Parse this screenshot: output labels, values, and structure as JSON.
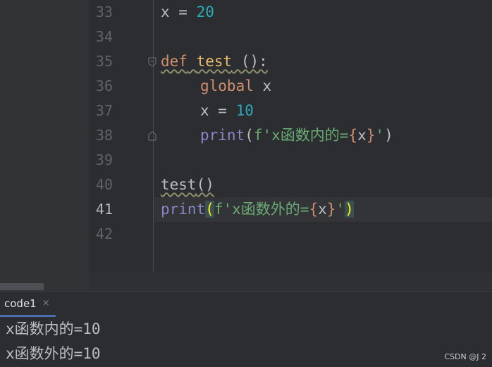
{
  "editor": {
    "line_numbers": [
      "33",
      "34",
      "35",
      "36",
      "37",
      "38",
      "39",
      "40",
      "41",
      "42"
    ],
    "active_line": "41",
    "lines": {
      "l33": {
        "var": "x",
        "op": " = ",
        "num": "20"
      },
      "l35": {
        "kw": "def",
        "space": " ",
        "name": "test",
        "parens": " ():"
      },
      "l36": {
        "kw": "global",
        "space": " ",
        "var": "x"
      },
      "l37": {
        "var": "x",
        "op": " = ",
        "num": "10"
      },
      "l38": {
        "builtin": "print",
        "open": "(",
        "str_start": "f'x函数内的=",
        "brace_open": "{",
        "var": "x",
        "brace_close": "}",
        "str_end": "'",
        "close": ")"
      },
      "l40": {
        "call": "test",
        "parens": "()"
      },
      "l41": {
        "builtin": "print",
        "open": "(",
        "str_start": "f'x函数外的=",
        "brace_open": "{",
        "var": "x",
        "brace_close": "}",
        "str_end": "'",
        "close": ")"
      }
    }
  },
  "run_tab": {
    "label": "code1",
    "close_glyph": "×"
  },
  "console": {
    "output": [
      "x函数内的=10",
      "x函数外的=10"
    ]
  },
  "watermark": "CSDN @J 2",
  "colors": {
    "background": "#2b2d30",
    "keyword": "#cf8e6d",
    "function_name": "#e8bf6a",
    "number": "#2aacb8",
    "builtin": "#8888c6",
    "string": "#6aab73",
    "bracket_highlight": "#ffef28",
    "tab_underline": "#4b6eaf"
  }
}
